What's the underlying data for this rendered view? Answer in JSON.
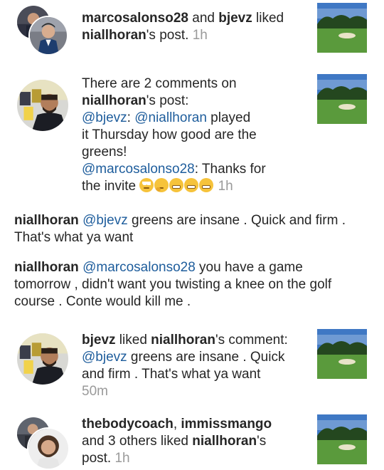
{
  "notifications": [
    {
      "users": [
        "marcosalonso28",
        "bjevz"
      ],
      "and": " and ",
      "action": " liked",
      "owner": "niallhoran",
      "owner_suffix": "'s post.",
      "time": "1h"
    },
    {
      "prefix": "There are 2 comments on",
      "owner": "niallhoran",
      "owner_suffix": "'s post:",
      "comments": [
        {
          "mention": "@bjevz",
          "sep": ": ",
          "mention2": "@niallhoran",
          "text_a": " played",
          "text_b": "it Thursday how good are the",
          "text_c": "greens!"
        },
        {
          "mention": "@marcosalonso28",
          "sep": ": Thanks for",
          "text_b": "the invite"
        }
      ],
      "emojis": [
        "face-with-rolling-eyes",
        "thinking-face",
        "grinning-face",
        "grinning-face",
        "grinning-face"
      ],
      "time": "1h"
    },
    {
      "user": "bjevz",
      "action": " liked ",
      "owner": "niallhoran",
      "owner_suffix": "'s comment:",
      "mention": "@bjevz",
      "text_a": " greens are insane . Quick",
      "text_b": "and firm . That's what ya want",
      "time": "50m"
    },
    {
      "users": [
        "thebodycoach",
        "immissmango"
      ],
      "sep": ", ",
      "others": "and 3 others liked ",
      "owner": "niallhoran",
      "owner_suffix": "'s",
      "post": "post.",
      "time": "1h"
    }
  ],
  "comments": [
    {
      "author": "niallhoran",
      "mention": "@bjevz",
      "line1": " greens are insane . Quick and firm .",
      "line2": "That's what ya want"
    },
    {
      "author": "niallhoran",
      "mention": "@marcosalonso28",
      "line1": " you have a game",
      "line2": "tomorrow , didn't want you twisting a knee on the golf",
      "line3": "course . Conte would kill me ."
    }
  ],
  "colors": {
    "mention": "#1e5d9c",
    "time": "#9a9a9a",
    "text": "#262626"
  }
}
